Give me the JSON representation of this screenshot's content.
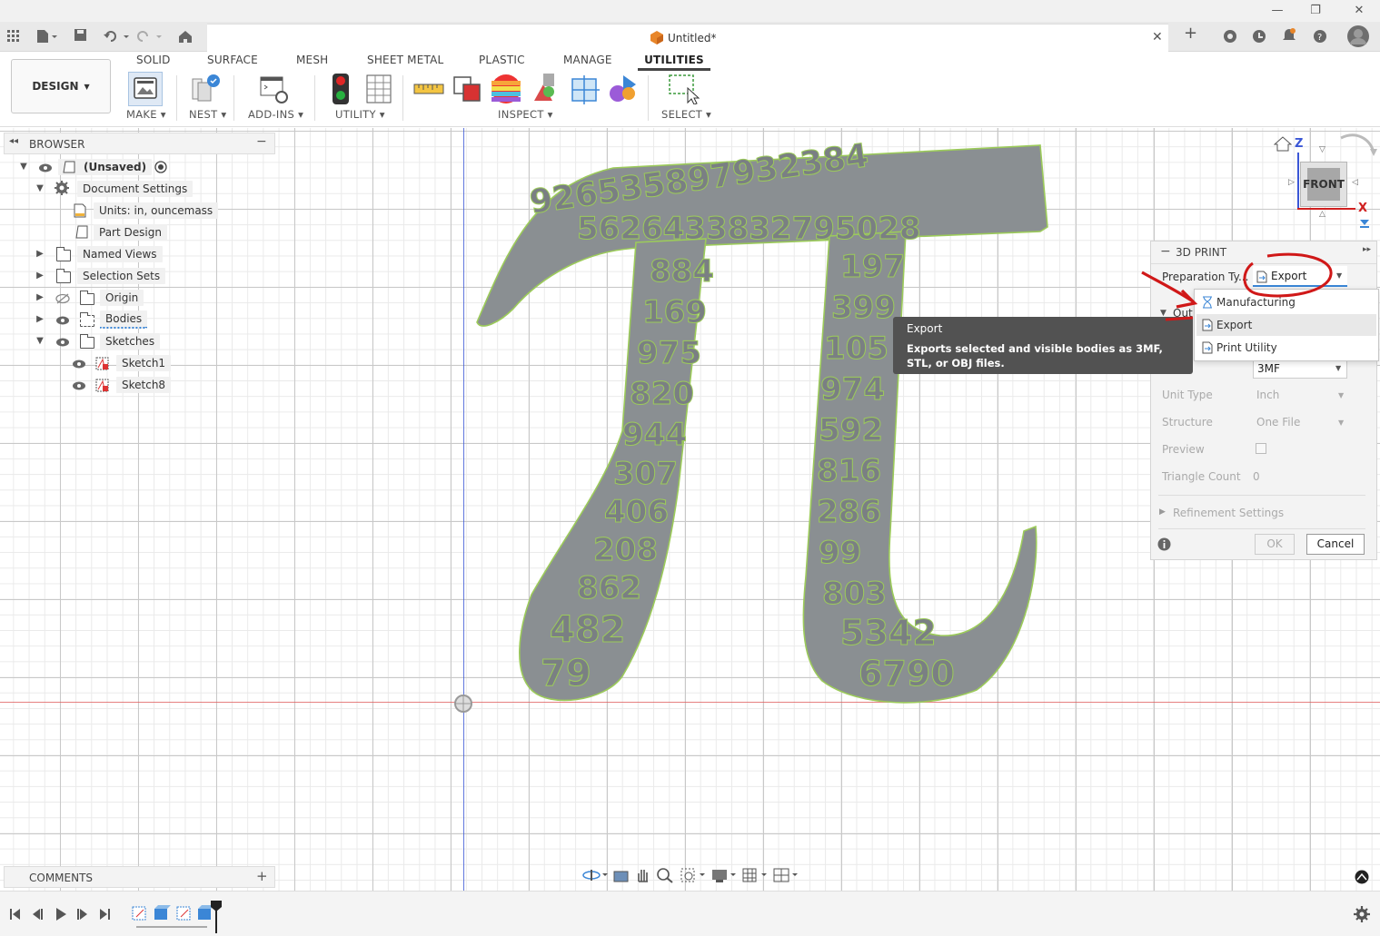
{
  "window": {
    "doc_title": "Untitled*",
    "controls": {
      "minimize": "—",
      "restore": "❐",
      "close": "✕"
    }
  },
  "ribbon": {
    "workspace": "DESIGN",
    "tabs": [
      "SOLID",
      "SURFACE",
      "MESH",
      "SHEET METAL",
      "PLASTIC",
      "MANAGE",
      "UTILITIES"
    ],
    "active_tab": "UTILITIES",
    "groups": [
      "MAKE",
      "NEST",
      "ADD-INS",
      "UTILITY",
      "INSPECT",
      "SELECT"
    ]
  },
  "browser": {
    "title": "BROWSER",
    "items": [
      {
        "label": "(Unsaved)"
      },
      {
        "label": "Document Settings"
      },
      {
        "label": "Units: in, ouncemass"
      },
      {
        "label": "Part Design"
      },
      {
        "label": "Named Views"
      },
      {
        "label": "Selection Sets"
      },
      {
        "label": "Origin"
      },
      {
        "label": "Bodies"
      },
      {
        "label": "Sketches"
      },
      {
        "label": "Sketch1"
      },
      {
        "label": "Sketch8"
      }
    ]
  },
  "comments": {
    "title": "COMMENTS",
    "add": "+"
  },
  "viewcube": {
    "face": "FRONT",
    "axis_z": "Z",
    "axis_x": "X"
  },
  "print_panel": {
    "title": "3D PRINT",
    "prep_label": "Preparation Ty...",
    "prep_value": "Export",
    "output_label": "Out",
    "format_label": "at",
    "format_value": "3MF",
    "unit_type_label": "Unit Type",
    "unit_type_value": "Inch",
    "structure_label": "Structure",
    "structure_value": "One File",
    "preview_label": "Preview",
    "triangle_label": "Triangle Count",
    "triangle_value": "0",
    "refinement_label": "Refinement Settings",
    "ok": "OK",
    "cancel": "Cancel"
  },
  "dropdown": {
    "options": [
      "Manufacturing",
      "Export",
      "Print Utility"
    ],
    "highlighted": "Export"
  },
  "tooltip": {
    "title": "Export",
    "body": "Exports selected and visible bodies as 3MF, STL, or OBJ files."
  },
  "pi_digits": {
    "top_row1": "926535897932384",
    "top_row2": "5626433832795028",
    "left_leg": [
      "884",
      "169",
      "975",
      "820",
      "944",
      "307",
      "406",
      "208",
      "862",
      "482",
      "79"
    ],
    "right_leg": [
      "197",
      "399",
      "105",
      "974",
      "592",
      "816",
      "286",
      "99",
      "803",
      "5342",
      "6790"
    ]
  },
  "colors": {
    "body_fill": "#8a8f92",
    "body_outline": "#9ccb5a",
    "annotation_red": "#d01818",
    "axis_blue": "#3b57d6",
    "axis_red": "#e06060"
  }
}
